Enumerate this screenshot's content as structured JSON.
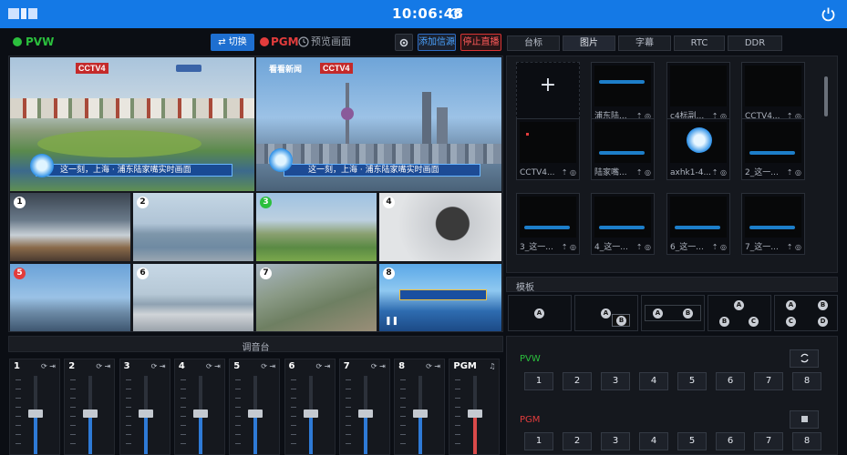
{
  "header": {
    "logo_text": "≋",
    "clock": "10:06:48",
    "clock_icon": "refresh-icon",
    "power_icon": "power-icon"
  },
  "colors": {
    "accent": "#1479e6",
    "pvw": "#2bbf3d",
    "pgm": "#e23c3c",
    "danger": "#d93434"
  },
  "toolbar": {
    "pvw_label": "PVW",
    "switch_label": "⇄ 切换",
    "pgm_label": "PGM",
    "preview_label": "预览画面",
    "add_source_label": "添加信源",
    "stop_live_label": "停止直播"
  },
  "main_views": {
    "left_caption": "这一刻，上海 · 浦东陆家嘴实时画面",
    "right_caption": "这一刻，上海 · 浦东陆家嘴实时画面",
    "left_logo": "CCTV4",
    "right_logo": "看看新闻",
    "right_logo2": "CCTV4"
  },
  "sources": [
    {
      "num": "1"
    },
    {
      "num": "2"
    },
    {
      "num": "3"
    },
    {
      "num": "4"
    },
    {
      "num": "5"
    },
    {
      "num": "6"
    },
    {
      "num": "7"
    },
    {
      "num": "8"
    }
  ],
  "right_tabs": [
    "台标",
    "图片",
    "字幕",
    "RTC",
    "DDR"
  ],
  "gallery": [
    {
      "caption": "+"
    },
    {
      "caption": "浦东陆..."
    },
    {
      "caption": "c4标副..."
    },
    {
      "caption": "CCTV4..."
    },
    {
      "caption": "CCTV4..."
    },
    {
      "caption": "陆家嘴..."
    },
    {
      "caption": "axhk1-4..."
    },
    {
      "caption": "2_这一..."
    },
    {
      "caption": "3_这一..."
    },
    {
      "caption": "4_这一..."
    },
    {
      "caption": "6_这一..."
    },
    {
      "caption": "7_这一..."
    }
  ],
  "template_section": {
    "title": "模板",
    "letters": [
      "A",
      "B",
      "C",
      "D"
    ]
  },
  "mixer": {
    "title": "调音台",
    "channels": [
      {
        "label": "1",
        "level": 0.52
      },
      {
        "label": "2",
        "level": 0.52
      },
      {
        "label": "3",
        "level": 0.52
      },
      {
        "label": "4",
        "level": 0.52
      },
      {
        "label": "5",
        "level": 0.52
      },
      {
        "label": "6",
        "level": 0.52
      },
      {
        "label": "7",
        "level": 0.52
      },
      {
        "label": "8",
        "level": 0.52
      },
      {
        "label": "PGM",
        "level": 0.52
      }
    ]
  },
  "switcher": {
    "pvw_label": "PVW",
    "pgm_label": "PGM",
    "buttons": [
      "1",
      "2",
      "3",
      "4",
      "5",
      "6",
      "7",
      "8"
    ]
  }
}
